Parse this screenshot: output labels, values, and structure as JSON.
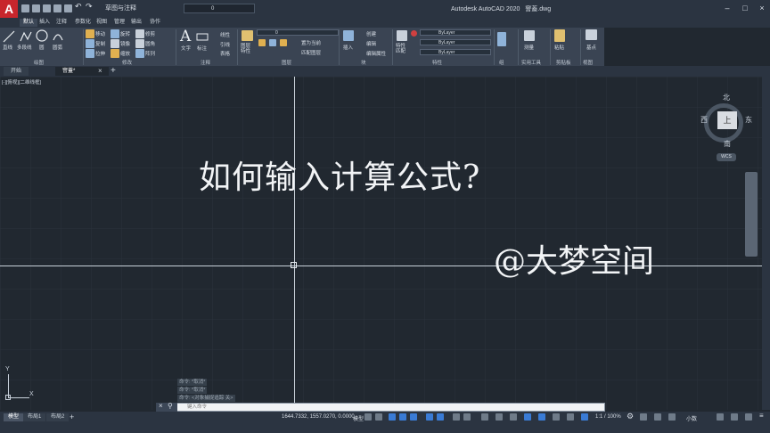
{
  "titlebar": {
    "app_letter": "A",
    "workspace": "草图与注释",
    "layer_value": "0",
    "app_title": "Autodesk AutoCAD 2020",
    "file_name": "窨蓋.dwg",
    "min": "–",
    "max": "□",
    "close": "×"
  },
  "menu_tabs": [
    "默认",
    "插入",
    "注释",
    "参数化",
    "视图",
    "管理",
    "输出",
    "协作"
  ],
  "ribbon": {
    "draw": {
      "label": "绘图",
      "line": "直线",
      "polyline": "多段线",
      "circle": "圆",
      "arc": "圆弧"
    },
    "modify": {
      "label": "修改",
      "move": "移动",
      "rotate": "旋转",
      "trim": "修剪",
      "copy": "复制",
      "mirror": "镜像",
      "fillet": "圆角",
      "stretch": "拉伸",
      "scale": "缩放",
      "array": "阵列"
    },
    "annotation": {
      "label": "注释",
      "text": "文字",
      "dimension": "标注",
      "linear": "线性",
      "leader": "引线",
      "table": "表格"
    },
    "layers": {
      "label": "图层",
      "properties": "图层特性",
      "layer_value": "0",
      "make_current": "置为当前",
      "match_layer": "匹配图层"
    },
    "block": {
      "label": "块",
      "insert": "插入",
      "create": "创建",
      "edit": "编辑",
      "edit_attr": "编辑属性"
    },
    "properties": {
      "label": "特性",
      "match": "特性匹配",
      "color": "ByLayer",
      "linetype": "ByLayer",
      "lineweight": "ByLayer"
    },
    "groups": {
      "label": "组"
    },
    "utilities": {
      "label": "实用工具",
      "measure": "测量"
    },
    "clipboard": {
      "label": "剪贴板",
      "paste": "粘贴"
    },
    "view": {
      "label": "视图",
      "base": "基点"
    }
  },
  "doc_tabs": [
    {
      "label": "开始"
    },
    {
      "label": "窨蓋*"
    }
  ],
  "canvas": {
    "viewport_label": "[-][俯视][二维线框]",
    "title_text": "如何输入计算公式?",
    "watermark": "@大梦空间"
  },
  "viewcube": {
    "north": "北",
    "south": "南",
    "east": "东",
    "west": "西",
    "top": "上",
    "wcs": "WCS"
  },
  "ucs": {
    "x": "X",
    "y": "Y"
  },
  "command": {
    "history": [
      "命令: *取消*",
      "命令: *取消*",
      "命令: <对象捕捉追踪 关>"
    ],
    "placeholder": "键入命令"
  },
  "status": {
    "layouts": [
      "模型",
      "布局1",
      "布局2"
    ],
    "coords": "1644.7332, 1557.0270, 0.0000",
    "model": "模型",
    "scale": "1:1 / 100%",
    "units": "小数"
  }
}
